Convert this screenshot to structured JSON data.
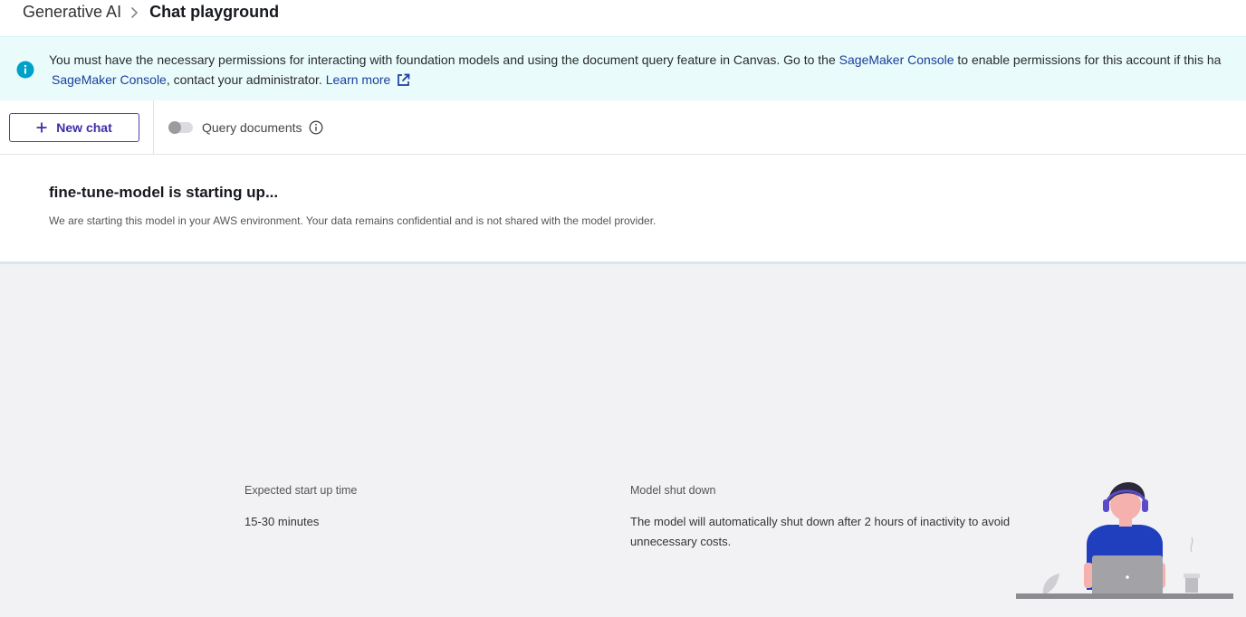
{
  "breadcrumb": {
    "parent": "Generative AI",
    "current": "Chat playground"
  },
  "banner": {
    "text_before": "You must have the necessary permissions for interacting with foundation models and using the document query feature in Canvas. Go to the ",
    "link1": "SageMaker Console",
    "text_after": " to enable permissions for this account if this ha",
    "link2": "SageMaker Console",
    "text_line2": ", contact your administrator. ",
    "learn_more": "Learn more",
    "icon": "info-icon",
    "accent_color": "#00a1c9"
  },
  "toolbar": {
    "new_chat_label": "New chat",
    "query_documents_label": "Query documents",
    "query_documents_enabled": false
  },
  "status": {
    "title": "fine-tune-model is starting up...",
    "description": "We are starting this model in your AWS environment. Your data remains confidential and is not shared with the model provider."
  },
  "details": {
    "startup_label": "Expected start up time",
    "startup_value": "15-30 minutes",
    "shutdown_label": "Model shut down",
    "shutdown_value": "The model will automatically shut down after 2 hours of inactivity to avoid unnecessary costs."
  },
  "colors": {
    "primary_button": "#3c2fa6",
    "link": "#1a3f9c",
    "banner_bg": "#e9fbfb",
    "page_bg": "#f2f2f4"
  }
}
